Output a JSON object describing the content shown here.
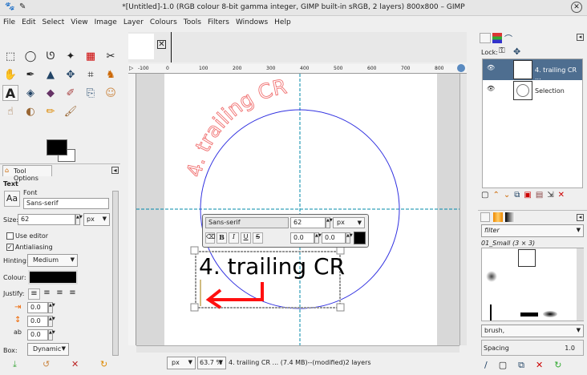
{
  "window": {
    "title": "*[Untitled]-1.0 (RGB colour 8-bit gamma integer, GIMP built-in sRGB, 2 layers) 800x800 – GIMP"
  },
  "menu": [
    "File",
    "Edit",
    "Select",
    "View",
    "Image",
    "Layer",
    "Colours",
    "Tools",
    "Filters",
    "Windows",
    "Help"
  ],
  "tool_options": {
    "tab": "Tool Options",
    "section": "Text",
    "font_label": "Font",
    "font": "Sans-serif",
    "size_label": "Size:",
    "size": "62",
    "unit": "px",
    "use_editor": "Use editor",
    "antialiasing": "Antialiasing",
    "hinting_label": "Hinting:",
    "hinting": "Medium",
    "colour_label": "Colour:",
    "justify_label": "Justify:",
    "indent": "0.0",
    "line_spacing": "0.0",
    "letter_spacing": "0.0",
    "box_label": "Box:",
    "box": "Dynamic"
  },
  "ruler": {
    "labels": [
      "-100",
      "0",
      "100",
      "200",
      "300",
      "400",
      "500",
      "600",
      "700",
      "800"
    ]
  },
  "canvas": {
    "curved_text": "4. trailing CR",
    "text": "4. trailing CR",
    "colors": {
      "circle": "#3030e0",
      "curved": "#f07070",
      "arrow": "#ff1010",
      "guide": "#0088aa"
    }
  },
  "text_toolbar": {
    "font": "Sans-serif",
    "size": "62",
    "unit": "px",
    "baseline": "0.0",
    "kerning": "0.0",
    "bold": "B",
    "italic": "I",
    "underline": "U",
    "strike": "S"
  },
  "status": {
    "unit": "px",
    "zoom": "63.7 %",
    "message": "4. trailing CR ... (7.4 MB)--(modified)2 layers"
  },
  "layers": {
    "lock_label": "Lock:",
    "items": [
      {
        "name": "4. trailing CR ...",
        "selected": true
      },
      {
        "name": "Selection",
        "selected": false
      }
    ]
  },
  "brushes": {
    "filter": "filter",
    "current": "01_Small (3 × 3)",
    "tag": "brush,",
    "spacing_label": "Spacing",
    "spacing": "1.0"
  }
}
